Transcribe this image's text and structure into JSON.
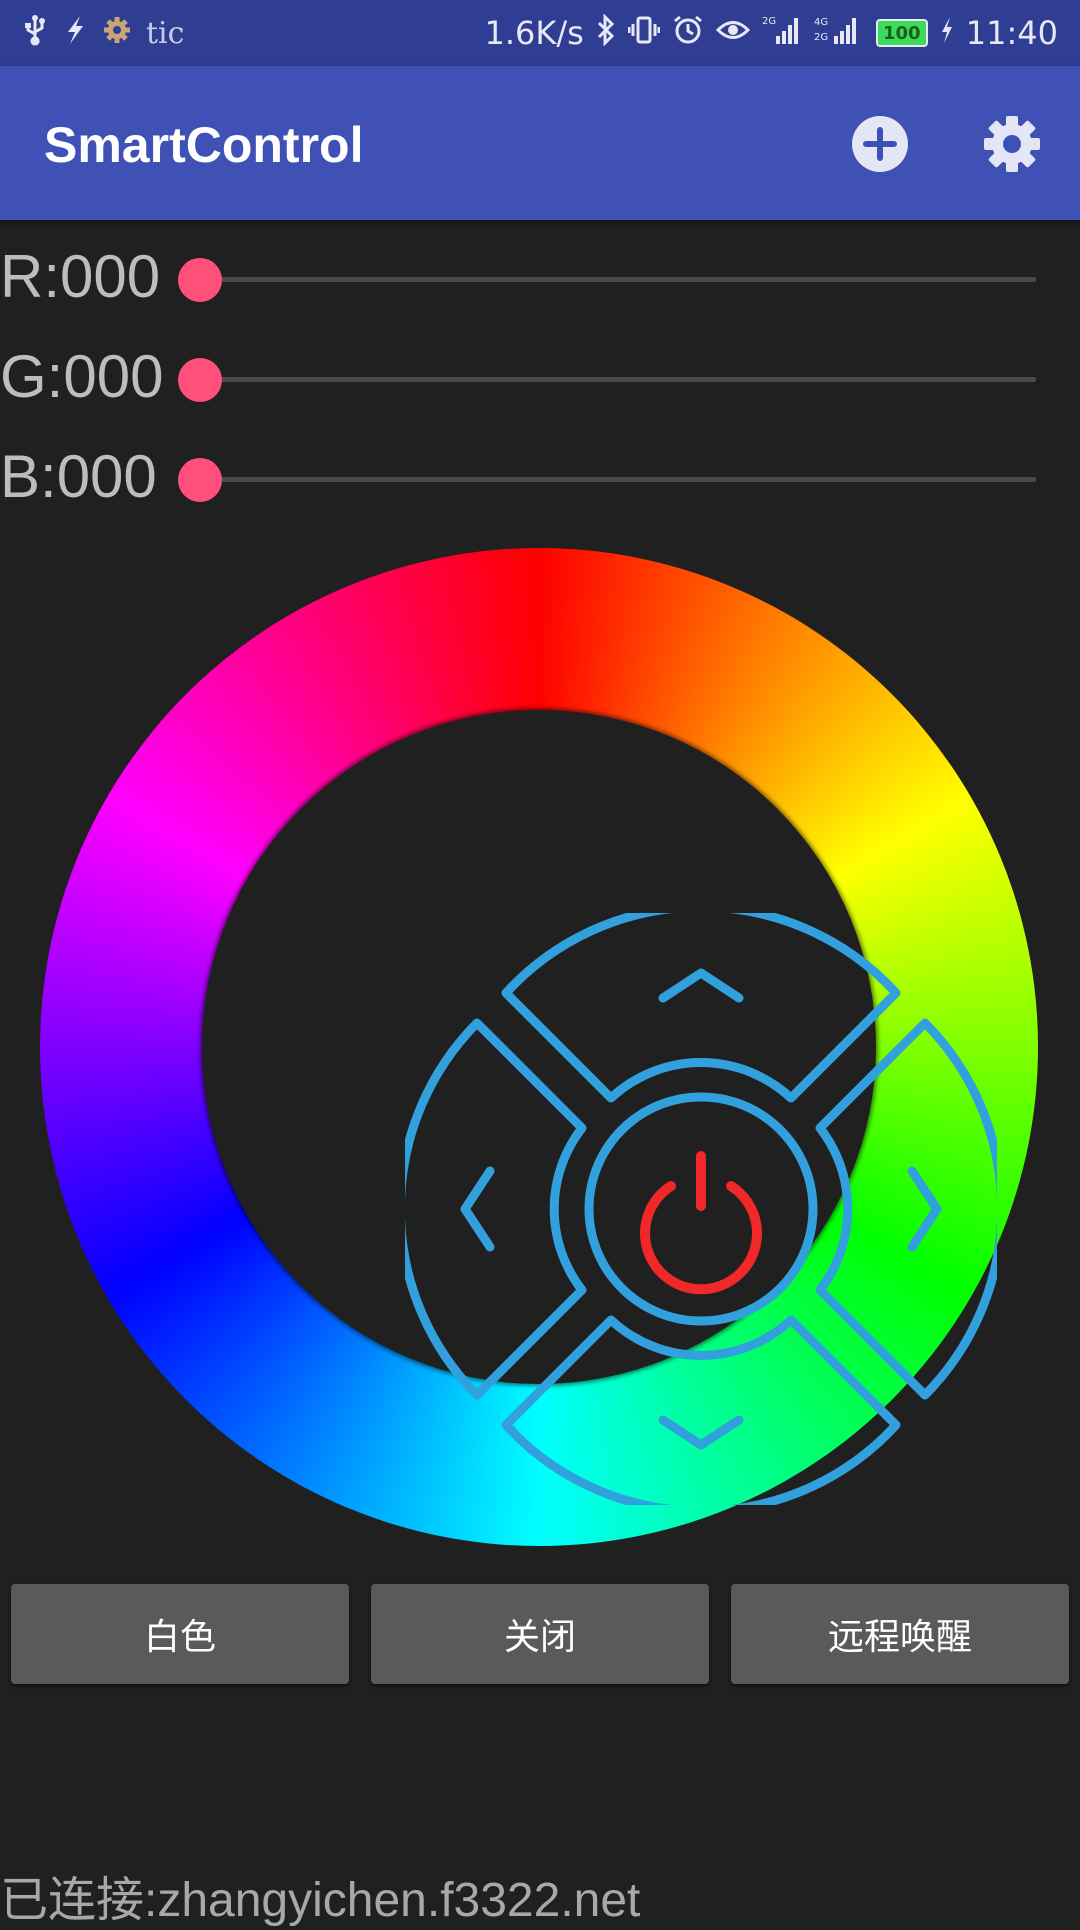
{
  "status_bar": {
    "left_icons": [
      "usb-icon",
      "flash-icon",
      "gear-icon"
    ],
    "left_text": "tic",
    "net_speed": "1.6K/s",
    "right_icons": [
      "bluetooth-icon",
      "vibrate-icon",
      "alarm-icon",
      "eye-icon",
      "signal-2g-icon",
      "signal-4g-icon"
    ],
    "battery": "100",
    "time": "11:40"
  },
  "app_bar": {
    "title": "SmartControl",
    "add_icon": "add-circle-icon",
    "settings_icon": "gear-icon"
  },
  "sliders": [
    {
      "label": "R:000",
      "value": 0,
      "max": 255
    },
    {
      "label": "G:000",
      "value": 0,
      "max": 255
    },
    {
      "label": "B:000",
      "value": 0,
      "max": 255
    }
  ],
  "colors": {
    "accent": "#ff4f7b",
    "pad_stroke": "#32a0dc",
    "power_icon": "#f02828",
    "app_bar": "#3f51b5",
    "status_bar": "#2f3e93"
  },
  "control_pad": {
    "icons": [
      "arrow-up-icon",
      "arrow-down-icon",
      "arrow-left-icon",
      "arrow-right-icon",
      "power-icon"
    ]
  },
  "buttons": [
    {
      "label": "白色"
    },
    {
      "label": "关闭"
    },
    {
      "label": "远程唤醒"
    }
  ],
  "footer": {
    "connection_text": "已连接:zhangyichen.f3322.net"
  }
}
